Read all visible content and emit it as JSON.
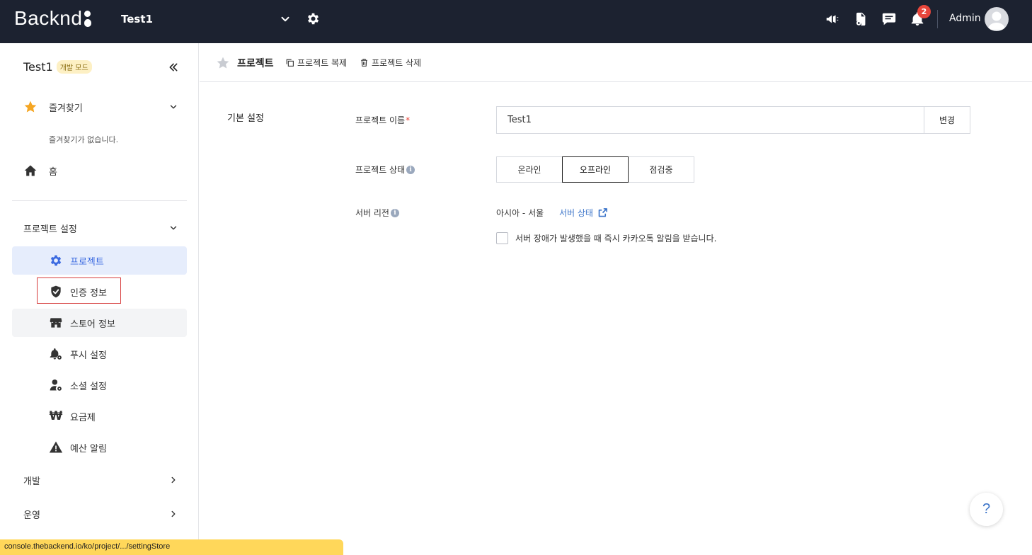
{
  "topbar": {
    "logo_text": "Backnd",
    "project_name": "Test1",
    "user_name": "Admin",
    "notification_count": "2"
  },
  "sidebar": {
    "project_title": "Test1",
    "mode_badge": "개발 모드",
    "favorites": {
      "label": "즐겨찾기",
      "empty_text": "즐겨찾기가 없습니다."
    },
    "home_label": "홈",
    "project_settings_label": "프로젝트 설정",
    "items": [
      {
        "label": "프로젝트"
      },
      {
        "label": "인증 정보"
      },
      {
        "label": "스토어 정보"
      },
      {
        "label": "푸시 설정"
      },
      {
        "label": "소셜 설정"
      },
      {
        "label": "요금제"
      },
      {
        "label": "예산 알림"
      }
    ],
    "dev_label": "개발",
    "ops_label": "운영"
  },
  "main": {
    "title": "프로젝트",
    "copy_label": "프로젝트 복제",
    "delete_label": "프로젝트 삭제",
    "section_label": "기본 설정",
    "name_label": "프로젝트 이름",
    "name_required": "*",
    "name_value": "Test1",
    "change_label": "변경",
    "status_label": "프로젝트 상태",
    "status_options": [
      "온라인",
      "오프라인",
      "점검중"
    ],
    "status_selected": "오프라인",
    "region_label": "서버 리전",
    "region_value": "아시아 - 서울",
    "server_status_link": "서버 상태",
    "kakao_alert_label": "서버 장애가 발생했을 때 즉시 카카오톡 알림을 받습니다."
  },
  "help_label": "?",
  "status_url": "console.thebackend.io/ko/project/.../settingStore",
  "colors": {
    "topbar_bg": "#1c2230",
    "accent": "#3b6ae0",
    "link": "#3b74c9",
    "badge": "#e8463b",
    "favorite_star": "#f5a623"
  }
}
